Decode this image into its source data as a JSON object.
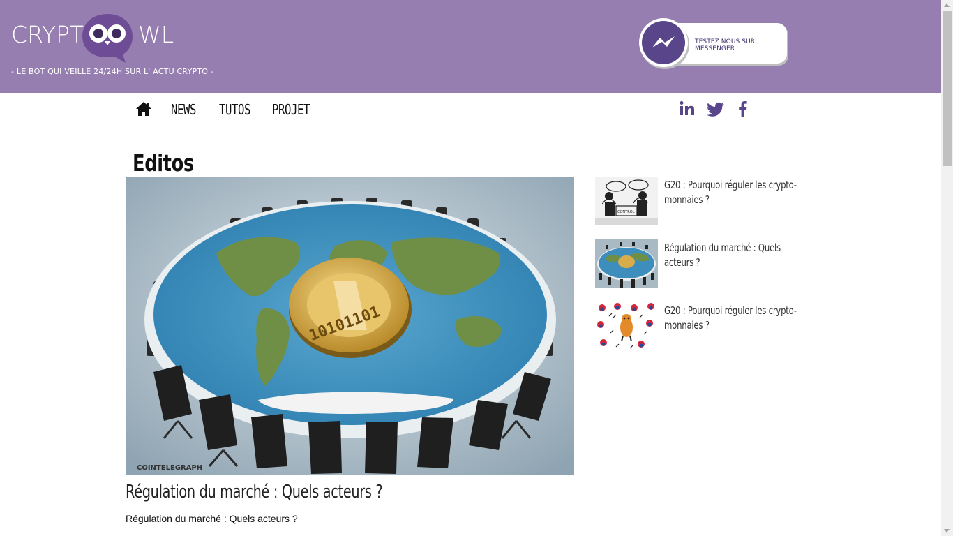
{
  "header": {
    "logo_text_left": "CRYPT",
    "logo_text_right": "WL",
    "tagline": "- LE BOT QUI VEILLE 24/24H  SUR L' ACTU CRYPTO -",
    "messenger_button": "TESTEZ NOUS SUR MESSENGER",
    "colors": {
      "header_bg": "#967eb0",
      "accent": "#58458a"
    }
  },
  "nav": {
    "home_icon": "home-icon",
    "items": [
      {
        "label": "NEWS"
      },
      {
        "label": "TUTOS"
      },
      {
        "label": "PROJET"
      }
    ],
    "social": [
      {
        "name": "linkedin-icon"
      },
      {
        "name": "twitter-icon"
      },
      {
        "name": "facebook-icon"
      }
    ]
  },
  "main": {
    "section_title": "Editos",
    "hero": {
      "image_watermark": "COINTELEGRAPH",
      "coin_text": "10101101",
      "title": "Régulation du marché : Quels acteurs ?",
      "excerpt": "Régulation du marché : Quels acteurs ?"
    }
  },
  "sidebar": {
    "articles": [
      {
        "title": "G20 : Pourquoi réguler les crypto-monnaies ?",
        "thumb_label": "CONTROL"
      },
      {
        "title": "Régulation du marché : Quels acteurs ?"
      },
      {
        "title": "G20 : Pourquoi réguler les crypto-monnaies ?"
      }
    ]
  }
}
